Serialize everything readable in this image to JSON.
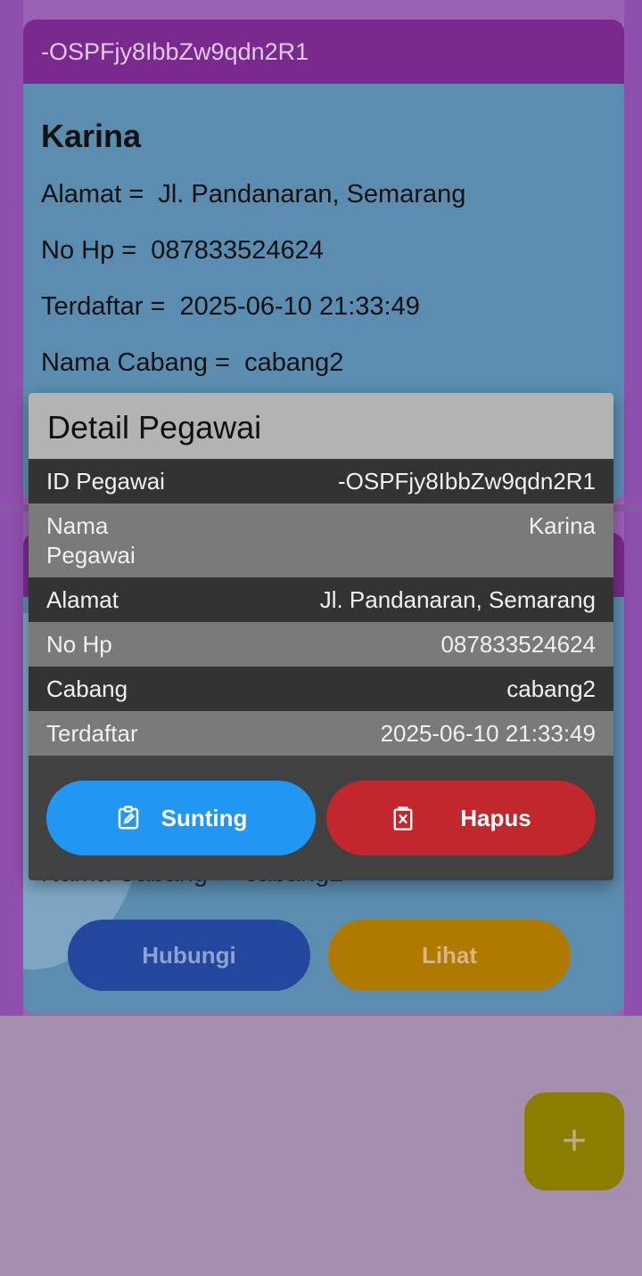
{
  "card1": {
    "id": "-OSPFjy8IbbZw9qdn2R1",
    "name": "Karina",
    "alamat": "Alamat =  Jl. Pandanaran, Semarang",
    "no_hp": "No Hp =  087833524624",
    "terdaftar": "Terdaftar =  2025-06-10 21:33:49",
    "cabang": "Nama Cabang =  cabang2"
  },
  "card2": {
    "peek_line": "Nama Cabang =  cabang2",
    "hubungi_label": "Hubungi",
    "lihat_label": "Lihat"
  },
  "dialog": {
    "title": "Detail Pegawai",
    "rows": [
      {
        "label": "ID Pegawai",
        "value": "-OSPFjy8IbbZw9qdn2R1"
      },
      {
        "label": "Nama Pegawai",
        "value": "Karina"
      },
      {
        "label": "Alamat",
        "value": "Jl. Pandanaran, Semarang"
      },
      {
        "label": "No Hp",
        "value": "087833524624"
      },
      {
        "label": "Cabang",
        "value": "cabang2"
      },
      {
        "label": "Terdaftar",
        "value": "2025-06-10 21:33:49"
      }
    ],
    "edit_label": "Sunting",
    "delete_label": "Hapus"
  },
  "fab": {
    "icon": "plus-icon",
    "symbol": "+"
  },
  "icons": {
    "edit": "edit-clipboard-icon",
    "delete": "delete-box-icon"
  }
}
